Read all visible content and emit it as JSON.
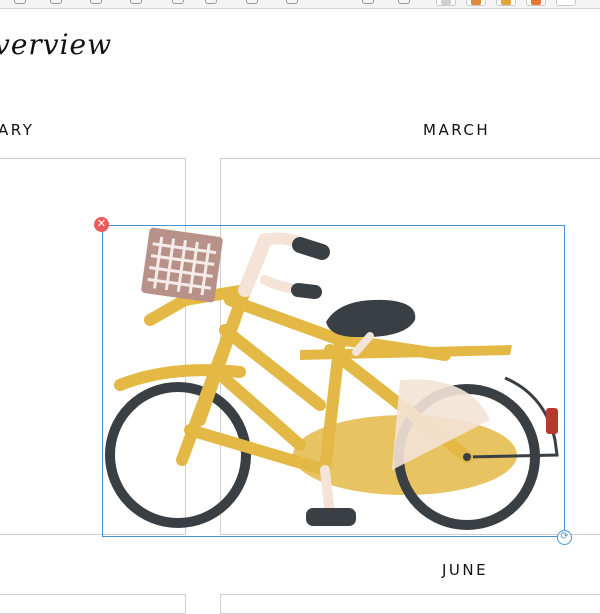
{
  "planner": {
    "title": "verview",
    "months": {
      "february": "ARY",
      "march": "MARCH",
      "june": "JUNE"
    }
  },
  "canvas": {
    "selected_image": {
      "name": "bicycle illustration",
      "delete_icon": "close-icon",
      "rotate_icon": "rotate-icon"
    }
  },
  "colors": {
    "accent_selection": "#4a90d9",
    "delete_handle": "#ec5a5a",
    "bike_frame": "#e3b845",
    "tires": "#3a3f44",
    "basket": "#b89189"
  }
}
